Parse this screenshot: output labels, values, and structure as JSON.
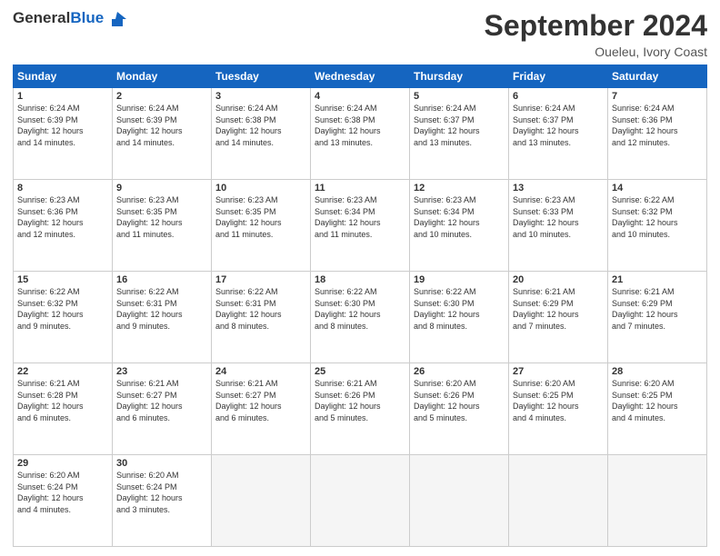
{
  "header": {
    "logo_general": "General",
    "logo_blue": "Blue",
    "month_title": "September 2024",
    "subtitle": "Oueleu, Ivory Coast"
  },
  "columns": [
    "Sunday",
    "Monday",
    "Tuesday",
    "Wednesday",
    "Thursday",
    "Friday",
    "Saturday"
  ],
  "weeks": [
    [
      {
        "day": "1",
        "info": "Sunrise: 6:24 AM\nSunset: 6:39 PM\nDaylight: 12 hours\nand 14 minutes."
      },
      {
        "day": "2",
        "info": "Sunrise: 6:24 AM\nSunset: 6:39 PM\nDaylight: 12 hours\nand 14 minutes."
      },
      {
        "day": "3",
        "info": "Sunrise: 6:24 AM\nSunset: 6:38 PM\nDaylight: 12 hours\nand 14 minutes."
      },
      {
        "day": "4",
        "info": "Sunrise: 6:24 AM\nSunset: 6:38 PM\nDaylight: 12 hours\nand 13 minutes."
      },
      {
        "day": "5",
        "info": "Sunrise: 6:24 AM\nSunset: 6:37 PM\nDaylight: 12 hours\nand 13 minutes."
      },
      {
        "day": "6",
        "info": "Sunrise: 6:24 AM\nSunset: 6:37 PM\nDaylight: 12 hours\nand 13 minutes."
      },
      {
        "day": "7",
        "info": "Sunrise: 6:24 AM\nSunset: 6:36 PM\nDaylight: 12 hours\nand 12 minutes."
      }
    ],
    [
      {
        "day": "8",
        "info": "Sunrise: 6:23 AM\nSunset: 6:36 PM\nDaylight: 12 hours\nand 12 minutes."
      },
      {
        "day": "9",
        "info": "Sunrise: 6:23 AM\nSunset: 6:35 PM\nDaylight: 12 hours\nand 11 minutes."
      },
      {
        "day": "10",
        "info": "Sunrise: 6:23 AM\nSunset: 6:35 PM\nDaylight: 12 hours\nand 11 minutes."
      },
      {
        "day": "11",
        "info": "Sunrise: 6:23 AM\nSunset: 6:34 PM\nDaylight: 12 hours\nand 11 minutes."
      },
      {
        "day": "12",
        "info": "Sunrise: 6:23 AM\nSunset: 6:34 PM\nDaylight: 12 hours\nand 10 minutes."
      },
      {
        "day": "13",
        "info": "Sunrise: 6:23 AM\nSunset: 6:33 PM\nDaylight: 12 hours\nand 10 minutes."
      },
      {
        "day": "14",
        "info": "Sunrise: 6:22 AM\nSunset: 6:32 PM\nDaylight: 12 hours\nand 10 minutes."
      }
    ],
    [
      {
        "day": "15",
        "info": "Sunrise: 6:22 AM\nSunset: 6:32 PM\nDaylight: 12 hours\nand 9 minutes."
      },
      {
        "day": "16",
        "info": "Sunrise: 6:22 AM\nSunset: 6:31 PM\nDaylight: 12 hours\nand 9 minutes."
      },
      {
        "day": "17",
        "info": "Sunrise: 6:22 AM\nSunset: 6:31 PM\nDaylight: 12 hours\nand 8 minutes."
      },
      {
        "day": "18",
        "info": "Sunrise: 6:22 AM\nSunset: 6:30 PM\nDaylight: 12 hours\nand 8 minutes."
      },
      {
        "day": "19",
        "info": "Sunrise: 6:22 AM\nSunset: 6:30 PM\nDaylight: 12 hours\nand 8 minutes."
      },
      {
        "day": "20",
        "info": "Sunrise: 6:21 AM\nSunset: 6:29 PM\nDaylight: 12 hours\nand 7 minutes."
      },
      {
        "day": "21",
        "info": "Sunrise: 6:21 AM\nSunset: 6:29 PM\nDaylight: 12 hours\nand 7 minutes."
      }
    ],
    [
      {
        "day": "22",
        "info": "Sunrise: 6:21 AM\nSunset: 6:28 PM\nDaylight: 12 hours\nand 6 minutes."
      },
      {
        "day": "23",
        "info": "Sunrise: 6:21 AM\nSunset: 6:27 PM\nDaylight: 12 hours\nand 6 minutes."
      },
      {
        "day": "24",
        "info": "Sunrise: 6:21 AM\nSunset: 6:27 PM\nDaylight: 12 hours\nand 6 minutes."
      },
      {
        "day": "25",
        "info": "Sunrise: 6:21 AM\nSunset: 6:26 PM\nDaylight: 12 hours\nand 5 minutes."
      },
      {
        "day": "26",
        "info": "Sunrise: 6:20 AM\nSunset: 6:26 PM\nDaylight: 12 hours\nand 5 minutes."
      },
      {
        "day": "27",
        "info": "Sunrise: 6:20 AM\nSunset: 6:25 PM\nDaylight: 12 hours\nand 4 minutes."
      },
      {
        "day": "28",
        "info": "Sunrise: 6:20 AM\nSunset: 6:25 PM\nDaylight: 12 hours\nand 4 minutes."
      }
    ],
    [
      {
        "day": "29",
        "info": "Sunrise: 6:20 AM\nSunset: 6:24 PM\nDaylight: 12 hours\nand 4 minutes."
      },
      {
        "day": "30",
        "info": "Sunrise: 6:20 AM\nSunset: 6:24 PM\nDaylight: 12 hours\nand 3 minutes."
      },
      {
        "day": "",
        "info": ""
      },
      {
        "day": "",
        "info": ""
      },
      {
        "day": "",
        "info": ""
      },
      {
        "day": "",
        "info": ""
      },
      {
        "day": "",
        "info": ""
      }
    ]
  ]
}
